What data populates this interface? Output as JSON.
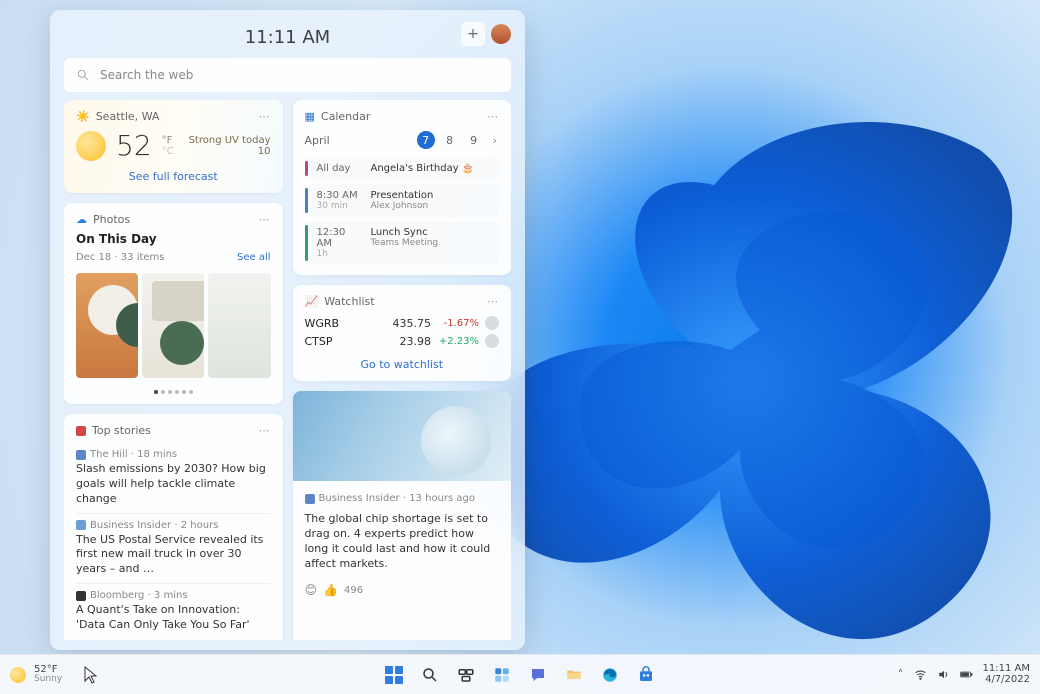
{
  "panel": {
    "time": "11:11 AM",
    "search_placeholder": "Search the web"
  },
  "weather": {
    "location": "Seattle, WA",
    "temp": "52",
    "unit_top": "°F",
    "unit_bottom": "°C",
    "desc_line1": "Strong UV today",
    "desc_line2": "10",
    "link": "See full forecast"
  },
  "photos": {
    "header": "Photos",
    "title": "On This Day",
    "sub": "Dec 18 · 33 items",
    "see_all": "See all"
  },
  "topstories": {
    "header": "Top stories",
    "items": [
      {
        "src": "The Hill · 18 mins",
        "icon_bg": "#5b85c7",
        "headline": "Slash emissions by 2030? How big goals will help tackle climate change"
      },
      {
        "src": "Business Insider · 2 hours",
        "icon_bg": "#6aa0d4",
        "headline": "The US Postal Service revealed its first new mail truck in over 30 years – and …"
      },
      {
        "src": "Bloomberg · 3 mins",
        "icon_bg": "#333333",
        "headline": "A Quant's Take on Innovation: 'Data Can Only Take You So Far'"
      }
    ]
  },
  "calendar": {
    "header": "Calendar",
    "month": "April",
    "days": [
      "7",
      "8",
      "9"
    ],
    "current_index": 0,
    "events": [
      {
        "time": "All day",
        "dur": "",
        "title": "Angela's Birthday 🎂",
        "who": ""
      },
      {
        "time": "8:30 AM",
        "dur": "30 min",
        "title": "Presentation",
        "who": "Alex Johnson"
      },
      {
        "time": "12:30 AM",
        "dur": "1h",
        "title": "Lunch Sync",
        "who": "Teams Meeting"
      }
    ]
  },
  "watchlist": {
    "header": "Watchlist",
    "rows": [
      {
        "sym": "WGRB",
        "price": "435.75",
        "chg": "-1.67%",
        "dir": "neg"
      },
      {
        "sym": "CTSP",
        "price": "23.98",
        "chg": "+2.23%",
        "dir": "pos"
      }
    ],
    "link": "Go to watchlist"
  },
  "featured": {
    "src": "Business Insider · 13 hours ago",
    "headline": "The global chip shortage is set to drag on. 4 experts predict how long it could last and how it could affect markets.",
    "reactions": "496"
  },
  "taskbar": {
    "weather_temp": "52°F",
    "weather_desc": "Sunny",
    "time": "11:11 AM",
    "date": "4/7/2022"
  }
}
